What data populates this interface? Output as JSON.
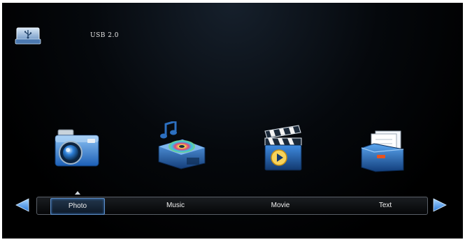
{
  "header": {
    "device_icon": "usb-drive-icon",
    "device_label": "USB  2.0"
  },
  "media_icons": [
    {
      "icon": "camera-icon",
      "label": "Photo"
    },
    {
      "icon": "music-player-icon",
      "label": "Music"
    },
    {
      "icon": "clapperboard-icon",
      "label": "Movie"
    },
    {
      "icon": "file-folder-icon",
      "label": "Text"
    }
  ],
  "nav": {
    "items": [
      {
        "label": "Photo",
        "selected": true
      },
      {
        "label": "Music",
        "selected": false
      },
      {
        "label": "Movie",
        "selected": false
      },
      {
        "label": "Text",
        "selected": false
      }
    ],
    "left_arrow": "arrow-left-icon",
    "right_arrow": "arrow-right-icon"
  },
  "colors": {
    "background": "#000000",
    "accent_blue": "#3a8fe0",
    "selection_border": "#5f8fc8"
  }
}
